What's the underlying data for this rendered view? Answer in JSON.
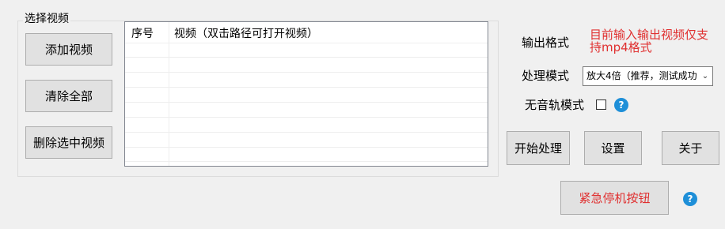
{
  "video_group": {
    "title": "选择视频",
    "add_label": "添加视频",
    "clear_label": "清除全部",
    "delete_label": "删除选中视频"
  },
  "list": {
    "col_index": "序号",
    "col_path": "视频（双击路径可打开视频）",
    "rows": []
  },
  "settings": {
    "output_format_label": "输出格式",
    "output_format_note": "目前输入输出视频仅支持mp4格式",
    "mode_label": "处理模式",
    "mode_value": "放大4倍（推荐，测试成功",
    "no_audio_label": "无音轨模式",
    "no_audio_checked": false
  },
  "buttons": {
    "start": "开始处理",
    "settings": "设置",
    "about": "关于",
    "emergency": "紧急停机按钮"
  },
  "icons": {
    "help": "?",
    "dropdown": "⌄"
  },
  "colors": {
    "accent_red": "#e03030",
    "help_blue": "#1e8fd8"
  }
}
